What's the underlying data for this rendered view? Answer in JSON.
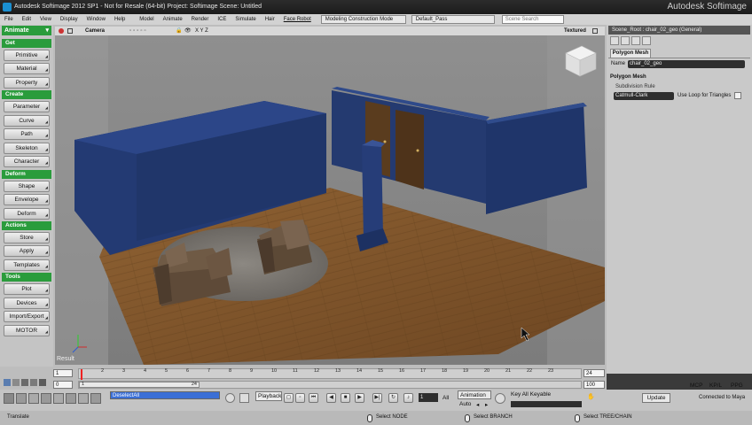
{
  "titlebar": {
    "title": "Autodesk Softimage 2012 SP1  -  Not for Resale (64-bit)   Project: Softimage   Scene: Untitled",
    "brand": "Autodesk Softimage"
  },
  "menubar": {
    "items": [
      "File",
      "Edit",
      "View",
      "Display",
      "Window",
      "Help",
      "Model",
      "Animate",
      "Render",
      "ICE",
      "Simulate",
      "Hair",
      "Face Robot"
    ],
    "layout_mode": "Modeling Construction Mode",
    "pass": "Default_Pass",
    "search_placeholder": "Scene Search"
  },
  "leftpanel": {
    "mode": "Animate",
    "sections": [
      {
        "header": "Get",
        "buttons": [
          "Primitive",
          "Material",
          "Property"
        ]
      },
      {
        "header": "Create",
        "buttons": [
          "Parameter",
          "Curve",
          "Path",
          "Skeleton",
          "Character"
        ]
      },
      {
        "header": "Deform",
        "buttons": [
          "Shape",
          "Envelope",
          "Deform"
        ]
      },
      {
        "header": "Actions",
        "buttons": [
          "Store",
          "Apply",
          "Templates"
        ]
      },
      {
        "header": "Tools",
        "buttons": [
          "Plot",
          "Devices",
          "Import/Export",
          "MOTOR"
        ]
      }
    ]
  },
  "viewport": {
    "camera": "Camera",
    "axes": "X  Y  Z",
    "shading": "Textured",
    "result_label": "Result"
  },
  "rightpanel": {
    "header": "Scene_Root : chair_02_geo (General)",
    "tab": "Polygon Mesh",
    "name_label": "Name",
    "name_value": "chair_02_geo",
    "section": "Polygon Mesh",
    "subsection": "Subdivision Rule",
    "rule_value": "Catmull-Clark",
    "loop_label": "Use Loop for Triangles"
  },
  "timeline": {
    "ticks": [
      "1",
      "2",
      "3",
      "4",
      "5",
      "6",
      "7",
      "8",
      "9",
      "10",
      "11",
      "12",
      "13",
      "14",
      "15",
      "16",
      "17",
      "18",
      "19",
      "20",
      "21",
      "22",
      "23"
    ],
    "start_frame": "1",
    "end_frame": "24",
    "range_start": "0",
    "range_mid_start": "1",
    "range_mid_end": "24",
    "range_end": "100"
  },
  "playbar": {
    "selection": "DeselectAll",
    "playback": "Playback",
    "frame_value": "1",
    "all_label": "All",
    "animation_label": "Animation",
    "auto_label": "Auto",
    "keyable_label": "Key All Keyable",
    "update_label": "Update",
    "mcp": "MCP",
    "kpl": "KP/L",
    "ppg": "PPG"
  },
  "statusbar": {
    "tool": "Translate",
    "hint_left": "Select NODE",
    "hint_mid": "Select BRANCH",
    "hint_right": "Select TREE/CHAIN",
    "connection": "Connected to Maya"
  },
  "colors": {
    "section_green": "#2a9c3c",
    "wall_blue": "#233a73",
    "floor_wood": "#8a5a2c"
  }
}
